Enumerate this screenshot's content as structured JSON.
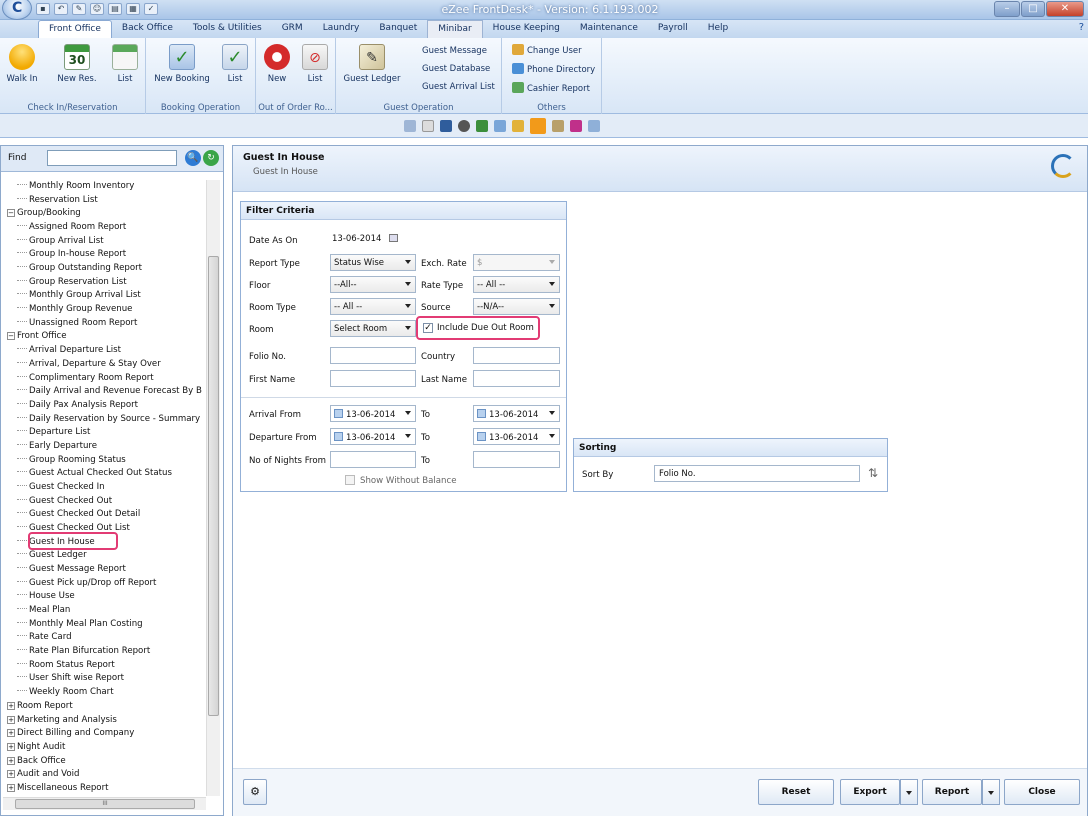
{
  "window": {
    "title": "eZee FrontDesk* - Version: 6.1.193.002",
    "min": "–",
    "max": "□",
    "close": "✕"
  },
  "menu_tabs": [
    "Front Office",
    "Back Office",
    "Tools & Utilities",
    "GRM",
    "Laundry",
    "Banquet",
    "Minibar",
    "House Keeping",
    "Maintenance",
    "Payroll",
    "Help"
  ],
  "help_icon": "?",
  "ribbon": {
    "walk_in": "Walk In",
    "new_res": "New Res.",
    "list1": "List",
    "group1": "Check In/Reservation",
    "new_booking": "New Booking",
    "list2": "List",
    "group2": "Booking Operation",
    "new": "New",
    "list3": "List",
    "group3": "Out of Order Ro...",
    "guest_ledger": "Guest Ledger",
    "guest_message": "Guest Message",
    "guest_database": "Guest Database",
    "guest_arrival_list": "Guest Arrival List",
    "group4": "Guest Operation",
    "change_user": "Change User",
    "phone_directory": "Phone Directory",
    "cashier_report": "Cashier Report",
    "group5": "Others",
    "calendar_num": "30"
  },
  "left": {
    "find_label": "Find",
    "search_btn": "🔍",
    "refresh_btn": "↻",
    "tree": [
      {
        "t": "Monthly Room Inventory",
        "lvl": 2
      },
      {
        "t": "Reservation List",
        "lvl": 2
      },
      {
        "t": "Group/Booking",
        "lvl": 1,
        "box": "−"
      },
      {
        "t": "Assigned Room Report",
        "lvl": 2
      },
      {
        "t": "Group Arrival List",
        "lvl": 2
      },
      {
        "t": "Group In-house Report",
        "lvl": 2
      },
      {
        "t": "Group Outstanding Report",
        "lvl": 2
      },
      {
        "t": "Group Reservation List",
        "lvl": 2
      },
      {
        "t": "Monthly Group Arrival List",
        "lvl": 2
      },
      {
        "t": "Monthly Group Revenue",
        "lvl": 2
      },
      {
        "t": "Unassigned Room Report",
        "lvl": 2
      },
      {
        "t": "Front Office",
        "lvl": 1,
        "box": "−"
      },
      {
        "t": "Arrival Departure List",
        "lvl": 2
      },
      {
        "t": "Arrival, Departure & Stay Over",
        "lvl": 2
      },
      {
        "t": "Complimentary Room Report",
        "lvl": 2
      },
      {
        "t": "Daily Arrival and Revenue Forecast By B",
        "lvl": 2
      },
      {
        "t": "Daily Pax Analysis Report",
        "lvl": 2
      },
      {
        "t": "Daily Reservation by Source - Summary",
        "lvl": 2
      },
      {
        "t": "Departure List",
        "lvl": 2
      },
      {
        "t": "Early Departure",
        "lvl": 2
      },
      {
        "t": "Group Rooming Status",
        "lvl": 2
      },
      {
        "t": "Guest Actual Checked Out Status",
        "lvl": 2
      },
      {
        "t": "Guest Checked In",
        "lvl": 2
      },
      {
        "t": "Guest Checked Out",
        "lvl": 2
      },
      {
        "t": "Guest Checked Out Detail",
        "lvl": 2
      },
      {
        "t": "Guest Checked Out List",
        "lvl": 2
      },
      {
        "t": "Guest In House",
        "lvl": 2
      },
      {
        "t": "Guest Ledger",
        "lvl": 2
      },
      {
        "t": "Guest Message Report",
        "lvl": 2
      },
      {
        "t": "Guest Pick up/Drop off Report",
        "lvl": 2
      },
      {
        "t": "House Use",
        "lvl": 2
      },
      {
        "t": "Meal Plan",
        "lvl": 2
      },
      {
        "t": "Monthly Meal Plan Costing",
        "lvl": 2
      },
      {
        "t": "Rate Card",
        "lvl": 2
      },
      {
        "t": "Rate Plan Bifurcation Report",
        "lvl": 2
      },
      {
        "t": "Room Status Report",
        "lvl": 2
      },
      {
        "t": "User Shift wise Report",
        "lvl": 2
      },
      {
        "t": "Weekly Room Chart",
        "lvl": 2
      },
      {
        "t": "Room Report",
        "lvl": 1,
        "box": "+"
      },
      {
        "t": "Marketing and Analysis",
        "lvl": 1,
        "box": "+"
      },
      {
        "t": "Direct Billing and Company",
        "lvl": 1,
        "box": "+"
      },
      {
        "t": "Night Audit",
        "lvl": 1,
        "box": "+"
      },
      {
        "t": "Back Office",
        "lvl": 1,
        "box": "+"
      },
      {
        "t": "Audit and Void",
        "lvl": 1,
        "box": "+"
      },
      {
        "t": "Miscellaneous Report",
        "lvl": 1,
        "box": "+"
      }
    ],
    "hscroll_grip": "III"
  },
  "header": {
    "title": "Guest In House",
    "subtitle": "Guest In House"
  },
  "filter": {
    "title": "Filter Criteria",
    "date_as_on_label": "Date As On",
    "date_as_on": "13-06-2014",
    "report_type_label": "Report Type",
    "report_type": "Status Wise",
    "exch_rate_label": "Exch. Rate",
    "exch_rate": "$",
    "floor_label": "Floor",
    "floor": "--All--",
    "rate_type_label": "Rate Type",
    "rate_type": "-- All --",
    "room_type_label": "Room Type",
    "room_type": "-- All --",
    "source_label": "Source",
    "source": "--N/A--",
    "room_label": "Room",
    "room": "Select Room",
    "include_due_out": "Include Due Out Room",
    "include_check": "✓",
    "folio_label": "Folio No.",
    "country_label": "Country",
    "first_name_label": "First Name",
    "last_name_label": "Last Name",
    "arrival_from_label": "Arrival From",
    "arrival_from": "13-06-2014",
    "to1": "To",
    "arrival_to": "13-06-2014",
    "departure_from_label": "Departure From",
    "departure_from": "13-06-2014",
    "to2": "To",
    "departure_to": "13-06-2014",
    "nights_from_label": "No of Nights From",
    "to3": "To",
    "show_without_balance": "Show Without Balance"
  },
  "sorting": {
    "title": "Sorting",
    "sort_by_label": "Sort By",
    "sort_by": "Folio No.",
    "sort_icon": "⇅"
  },
  "buttons": {
    "reset": "Reset",
    "export": "Export",
    "report": "Report",
    "close": "Close",
    "settings_icon": "⚙"
  },
  "colors": {
    "highlight": "#e23b74",
    "ribbon_blue": "#1c4f9c"
  }
}
